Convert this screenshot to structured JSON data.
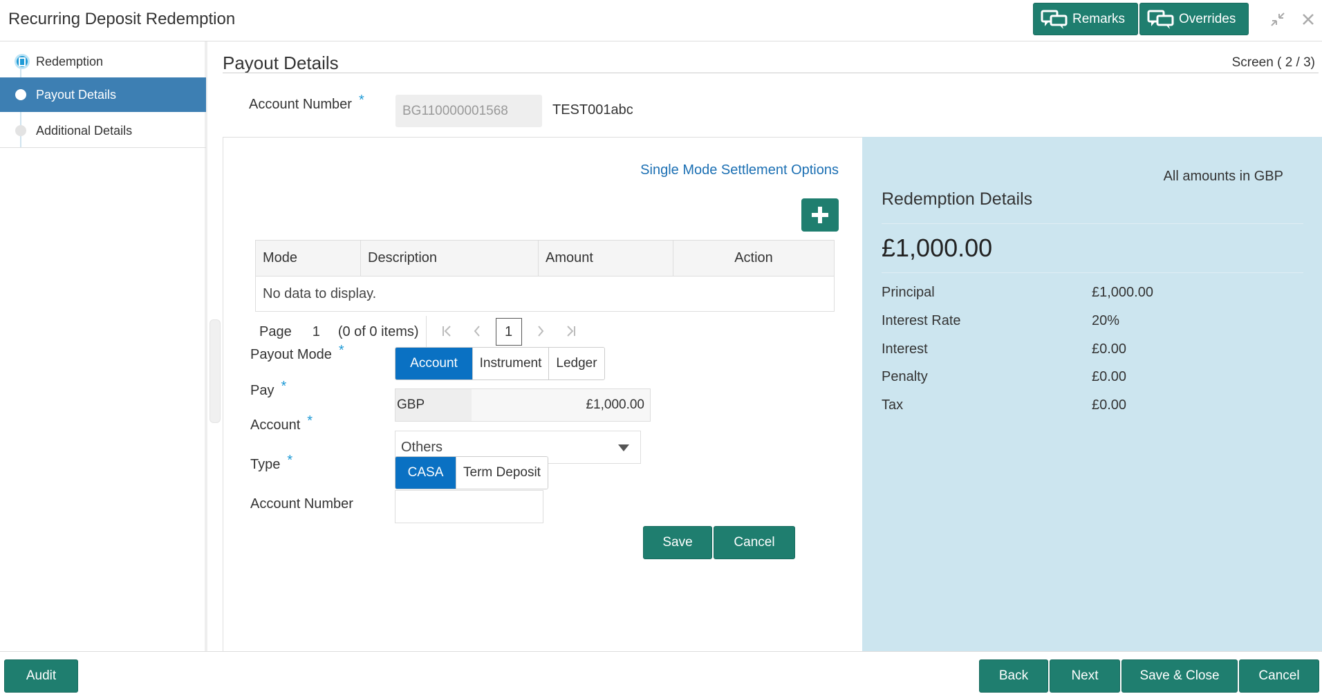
{
  "app": {
    "title": "Recurring Deposit Redemption"
  },
  "header": {
    "remarks_label": "Remarks",
    "overrides_label": "Overrides"
  },
  "sidebar": {
    "steps": [
      {
        "label": "Redemption"
      },
      {
        "label": "Payout Details"
      },
      {
        "label": "Additional Details"
      }
    ]
  },
  "page": {
    "title": "Payout Details",
    "screen_indicator": "Screen ( 2 / 3)",
    "account_number_label": "Account Number",
    "account_number_value": "BG110000001568",
    "account_name": "TEST001abc"
  },
  "settlement": {
    "link_label": "Single Mode Settlement Options",
    "grid": {
      "columns": [
        "Mode",
        "Description",
        "Amount",
        "Action"
      ],
      "empty_text": "No data to display."
    },
    "pager": {
      "page_label": "Page",
      "page_number": "1",
      "items_text": "(0 of 0 items)",
      "current_page": "1"
    }
  },
  "form": {
    "payout_mode_label": "Payout Mode",
    "payout_modes": [
      "Account",
      "Instrument",
      "Ledger"
    ],
    "payout_mode_selected": "Account",
    "pay_label": "Pay",
    "pay_currency": "GBP",
    "pay_amount": "£1,000.00",
    "account_label": "Account",
    "account_value": "Others",
    "type_label": "Type",
    "types": [
      "CASA",
      "Term Deposit"
    ],
    "type_selected": "CASA",
    "account_number_label": "Account Number",
    "account_number_value": "",
    "save_label": "Save",
    "cancel_label": "Cancel"
  },
  "summary": {
    "note": "All amounts in GBP",
    "title": "Redemption Details",
    "total": "£1,000.00",
    "rows": [
      {
        "label": "Principal",
        "value": "£1,000.00"
      },
      {
        "label": "Interest Rate",
        "value": "20%"
      },
      {
        "label": "Interest",
        "value": "£0.00"
      },
      {
        "label": "Penalty",
        "value": "£0.00"
      },
      {
        "label": "Tax",
        "value": "£0.00"
      }
    ]
  },
  "footer": {
    "audit_label": "Audit",
    "back_label": "Back",
    "next_label": "Next",
    "save_close_label": "Save & Close",
    "cancel_label": "Cancel"
  },
  "colors": {
    "primary": "#1f7e6f",
    "active_step": "#3d7fb3",
    "toggle_on": "#0a71c3",
    "summary_bg": "#cce5ef",
    "link": "#1b6fb3"
  }
}
